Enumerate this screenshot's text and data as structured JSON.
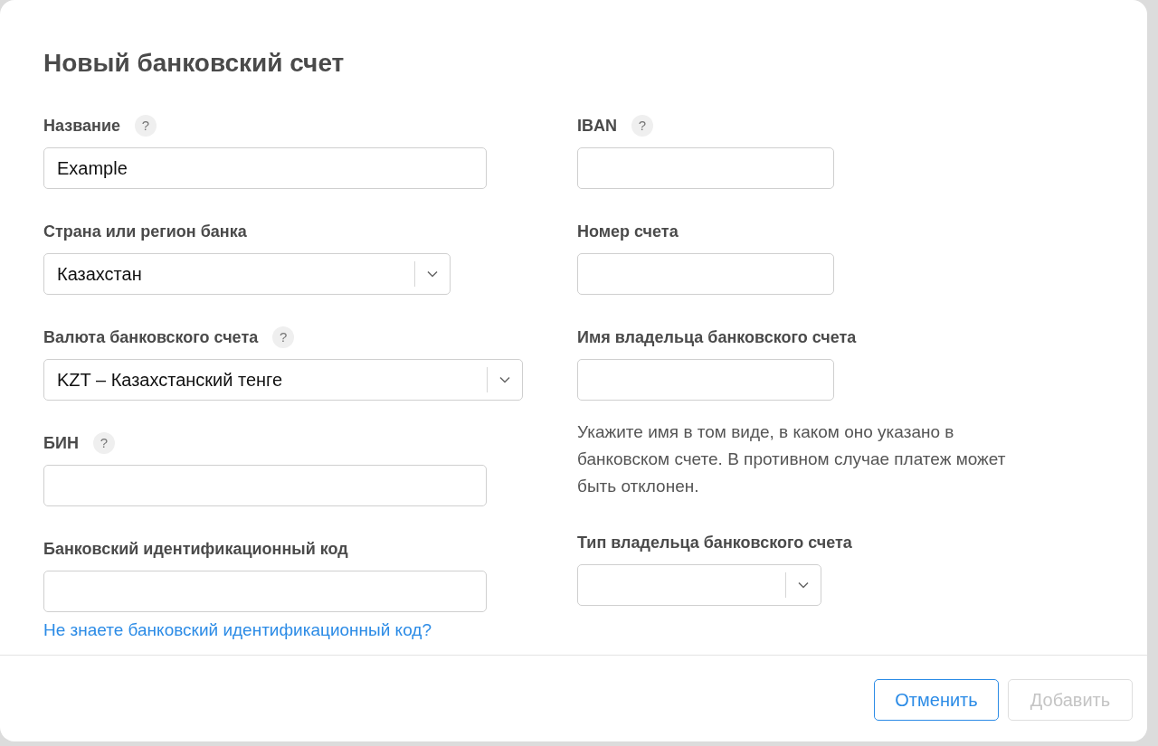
{
  "dialog": {
    "title": "Новый банковский счет",
    "left_fields": [
      {
        "kind": "text",
        "label": "Название",
        "help": "?",
        "value": "Example"
      },
      {
        "kind": "select",
        "label": "Страна или регион банка",
        "value": "Казахстан"
      },
      {
        "kind": "select",
        "label": "Валюта банковского счета",
        "help": "?",
        "value": "KZT – Казахстанский тенге"
      },
      {
        "kind": "text",
        "label": "БИН",
        "help": "?"
      },
      {
        "kind": "text",
        "label": "Банковский идентификационный код"
      }
    ],
    "link": "Не знаете банковский идентификационный код?",
    "right_fields": [
      {
        "kind": "text",
        "label": "IBAN",
        "help": "?"
      },
      {
        "kind": "text",
        "label": "Номер счета"
      },
      {
        "kind": "text",
        "label": "Имя владельца банковского счета",
        "note": "Укажите имя в том виде, в каком оно указано в банковском счете. В противном случае платеж может быть отклонен."
      },
      {
        "kind": "select",
        "label": "Тип владельца банковского счета"
      }
    ]
  },
  "buttons": [
    {
      "label": "Отменить",
      "disabled": false
    },
    {
      "label": "Добавить",
      "disabled": true
    }
  ]
}
